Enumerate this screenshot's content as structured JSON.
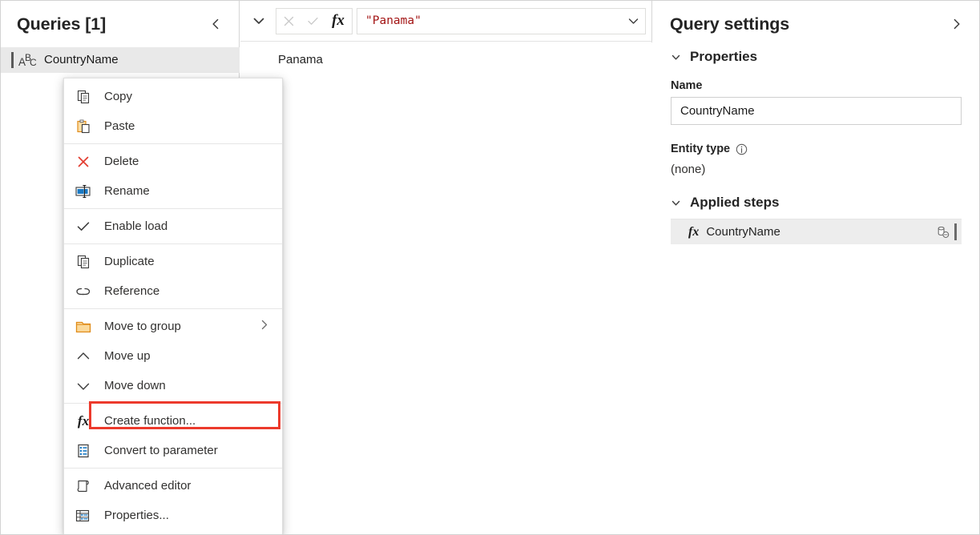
{
  "queries_pane": {
    "title": "Queries [1]",
    "collapse_icon": "chevron-left-icon",
    "items": [
      {
        "label": "CountryName",
        "type_icon": "abc-text-type-icon",
        "selected": true
      }
    ]
  },
  "context_menu": {
    "items": [
      {
        "id": "copy",
        "label": "Copy",
        "icon": "copy-icon",
        "type": "item"
      },
      {
        "id": "paste",
        "label": "Paste",
        "icon": "paste-icon",
        "type": "item"
      },
      {
        "id": "sep1",
        "label": "",
        "icon": "",
        "type": "separator"
      },
      {
        "id": "delete",
        "label": "Delete",
        "icon": "delete-x-icon",
        "type": "item"
      },
      {
        "id": "rename",
        "label": "Rename",
        "icon": "rename-icon",
        "type": "item"
      },
      {
        "id": "sep2",
        "label": "",
        "icon": "",
        "type": "separator"
      },
      {
        "id": "enable-load",
        "label": "Enable load",
        "icon": "checkmark-icon",
        "type": "item"
      },
      {
        "id": "sep3",
        "label": "",
        "icon": "",
        "type": "separator"
      },
      {
        "id": "duplicate",
        "label": "Duplicate",
        "icon": "duplicate-icon",
        "type": "item"
      },
      {
        "id": "reference",
        "label": "Reference",
        "icon": "reference-link-icon",
        "type": "item"
      },
      {
        "id": "sep4",
        "label": "",
        "icon": "",
        "type": "separator"
      },
      {
        "id": "move-to-group",
        "label": "Move to group",
        "icon": "folder-icon",
        "type": "submenu"
      },
      {
        "id": "move-up",
        "label": "Move up",
        "icon": "chevron-up-icon",
        "type": "item"
      },
      {
        "id": "move-down",
        "label": "Move down",
        "icon": "chevron-down-icon",
        "type": "item"
      },
      {
        "id": "sep5",
        "label": "",
        "icon": "",
        "type": "separator"
      },
      {
        "id": "create-function",
        "label": "Create function...",
        "icon": "fx-icon",
        "type": "item"
      },
      {
        "id": "convert-to-parameter",
        "label": "Convert to parameter",
        "icon": "parameter-list-icon",
        "type": "item",
        "highlighted": true
      },
      {
        "id": "sep6",
        "label": "",
        "icon": "",
        "type": "separator"
      },
      {
        "id": "advanced-editor",
        "label": "Advanced editor",
        "icon": "advanced-editor-icon",
        "type": "item"
      },
      {
        "id": "properties",
        "label": "Properties...",
        "icon": "properties-table-icon",
        "type": "item"
      }
    ],
    "highlight_color": "#ec3a2c"
  },
  "formula_bar": {
    "expand_icon": "chevron-down-icon",
    "cancel_icon": "cancel-x-icon",
    "accept_icon": "accept-check-icon",
    "fx_label": "fx",
    "value": "\"Panama\"",
    "value_color": "#a31515",
    "dropdown_icon": "chevron-down-icon"
  },
  "preview": {
    "value": "Panama"
  },
  "query_settings": {
    "title": "Query settings",
    "collapse_icon": "chevron-right-icon",
    "properties_section": {
      "label": "Properties",
      "expanded": true,
      "name_label": "Name",
      "name_value": "CountryName",
      "entity_type_label": "Entity type",
      "entity_type_info_icon": "info-circle-icon",
      "entity_type_value": "(none)"
    },
    "applied_steps_section": {
      "label": "Applied steps",
      "expanded": true,
      "steps": [
        {
          "name": "CountryName",
          "icon": "fx-icon",
          "action_icon": "delete-step-icon",
          "selected": true
        }
      ]
    }
  }
}
